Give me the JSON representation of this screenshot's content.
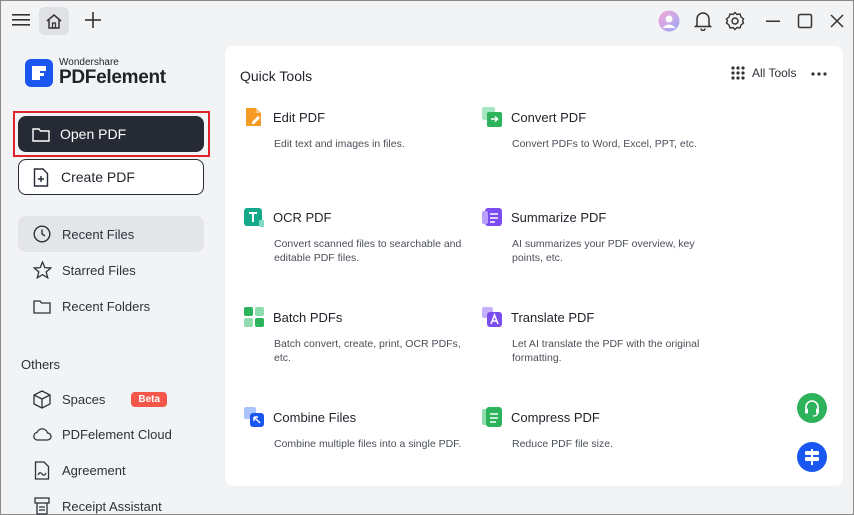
{
  "sidebar": {
    "logo": {
      "brand_small": "Wondershare",
      "brand_big": "PDFelement"
    },
    "open_label": "Open PDF",
    "create_label": "Create PDF",
    "nav": [
      {
        "label": "Recent Files",
        "icon": "clock-icon",
        "active": true
      },
      {
        "label": "Starred Files",
        "icon": "star-icon",
        "active": false
      },
      {
        "label": "Recent Folders",
        "icon": "folder-icon",
        "active": false
      }
    ],
    "others_label": "Others",
    "others": [
      {
        "label": "Spaces",
        "icon": "cube-icon",
        "badge": "Beta"
      },
      {
        "label": "PDFelement Cloud",
        "icon": "cloud-icon"
      },
      {
        "label": "Agreement",
        "icon": "agreement-icon"
      },
      {
        "label": "Receipt Assistant",
        "icon": "receipt-icon"
      }
    ]
  },
  "main": {
    "title": "Quick Tools",
    "all_tools_label": "All Tools",
    "tools": [
      {
        "name": "Edit PDF",
        "desc": "Edit text and images in files.",
        "icon": "edit-pdf-icon",
        "color": "#f59a23"
      },
      {
        "name": "Convert PDF",
        "desc": "Convert PDFs to Word, Excel, PPT, etc.",
        "icon": "convert-pdf-icon",
        "color": "#2cb35c"
      },
      {
        "name": "OCR PDF",
        "desc": "Convert scanned files to searchable and editable PDF files.",
        "icon": "ocr-pdf-icon",
        "color": "#15a88a"
      },
      {
        "name": "Summarize PDF",
        "desc": "AI summarizes your PDF overview, key points, etc.",
        "icon": "summarize-pdf-icon",
        "color": "#7b4df0"
      },
      {
        "name": "Batch PDFs",
        "desc": "Batch convert, create, print, OCR PDFs, etc.",
        "icon": "batch-pdfs-icon",
        "color": "#2cb35c"
      },
      {
        "name": "Translate PDF",
        "desc": "Let AI translate the PDF with the original formatting.",
        "icon": "translate-pdf-icon",
        "color": "#7b4df0"
      },
      {
        "name": "Combine Files",
        "desc": "Combine multiple files into a single PDF.",
        "icon": "combine-files-icon",
        "color": "#1a56f0"
      },
      {
        "name": "Compress PDF",
        "desc": "Reduce PDF file size.",
        "icon": "compress-pdf-icon",
        "color": "#2cb35c"
      }
    ]
  },
  "colors": {
    "accent": "#1a56f0",
    "dark_button": "#262a35",
    "highlight": "#e0222a",
    "beta_badge": "#f4574a"
  }
}
